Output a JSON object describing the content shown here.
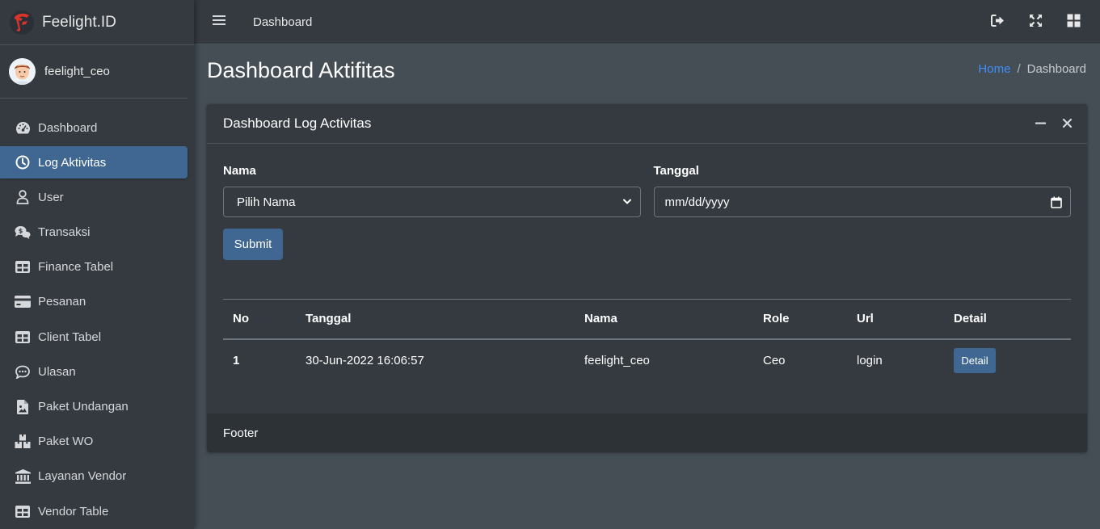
{
  "brand": {
    "name": "Feelight.ID",
    "logo_icon": "feelight-logo"
  },
  "user": {
    "name": "feelight_ceo",
    "avatar_icon": "user-avatar"
  },
  "sidebar": {
    "items": [
      {
        "label": "Dashboard",
        "icon": "gauge-icon",
        "active": false
      },
      {
        "label": "Log Aktivitas",
        "icon": "clock-icon",
        "active": true
      },
      {
        "label": "User",
        "icon": "user-icon",
        "active": false
      },
      {
        "label": "Transaksi",
        "icon": "comments-dollar-icon",
        "active": false
      },
      {
        "label": "Finance Tabel",
        "icon": "table-icon",
        "active": false
      },
      {
        "label": "Pesanan",
        "icon": "credit-card-icon",
        "active": false
      },
      {
        "label": "Client Tabel",
        "icon": "table-icon",
        "active": false
      },
      {
        "label": "Ulasan",
        "icon": "comment-dots-icon",
        "active": false
      },
      {
        "label": "Paket Undangan",
        "icon": "file-image-icon",
        "active": false
      },
      {
        "label": "Paket WO",
        "icon": "boxes-icon",
        "active": false
      },
      {
        "label": "Layanan Vendor",
        "icon": "landmark-icon",
        "active": false
      },
      {
        "label": "Vendor Table",
        "icon": "table-icon",
        "active": false
      }
    ]
  },
  "topbar": {
    "title": "Dashboard"
  },
  "header": {
    "title": "Dashboard Aktifitas",
    "breadcrumb": {
      "home": "Home",
      "separator": "/",
      "current": "Dashboard"
    }
  },
  "card": {
    "title": "Dashboard Log Activitas",
    "form": {
      "nama_label": "Nama",
      "nama_value": "Pilih Nama",
      "tanggal_label": "Tanggal",
      "tanggal_placeholder": "mm/dd/yyyy",
      "submit_label": "Submit"
    },
    "table": {
      "headers": [
        "No",
        "Tanggal",
        "Nama",
        "Role",
        "Url",
        "Detail"
      ],
      "rows": [
        {
          "no": "1",
          "tanggal": "30-Jun-2022 16:06:57",
          "nama": "feelight_ceo",
          "role": "Ceo",
          "url": "login",
          "detail": "Detail"
        }
      ]
    },
    "footer": "Footer"
  },
  "colors": {
    "sidebar_bg": "#343a40",
    "content_bg": "#454d55",
    "active_item": "#3f6791",
    "link": "#3f8ef8",
    "footer_bg": "#2d3237"
  }
}
